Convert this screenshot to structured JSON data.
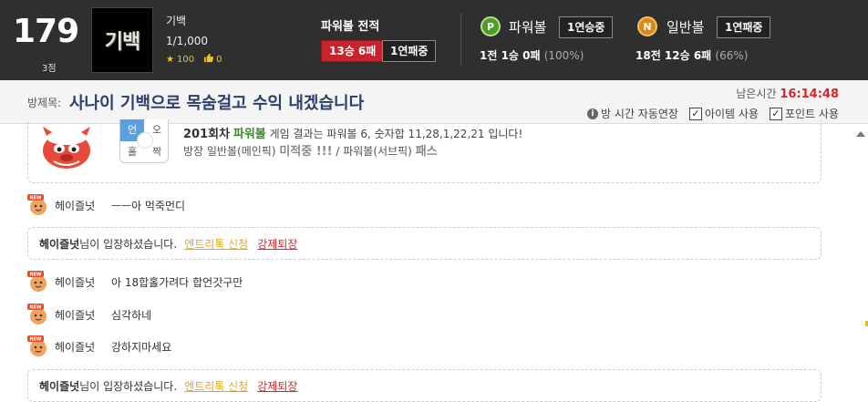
{
  "header": {
    "rank": "179",
    "rank_sub": "3점",
    "logo_text": "기백",
    "user_name": "기백",
    "user_count": "1/1,000",
    "star_count": "100",
    "like_count": "0"
  },
  "powerball_record": {
    "title": "파워볼 전적",
    "record_badge": "13승 6패",
    "streak_badge": "1연패중"
  },
  "ball_stats": [
    {
      "icon": "P",
      "name": "파워볼",
      "streak": "1연승중",
      "record": "1전 1승 0패",
      "percent": "(100%)",
      "color": "#4f9a2a"
    },
    {
      "icon": "N",
      "name": "일반볼",
      "streak": "1연패중",
      "record": "18전 12승 6패",
      "percent": "(66%)",
      "color": "#d98a1a"
    }
  ],
  "room": {
    "label": "방제목:",
    "title": "사나이 기백으로 목숨걸고 수익 내겠습니다",
    "timer_label": "남은시간",
    "timer_value": "16:14:48",
    "option_auto": "방 시간 자동연장",
    "option_item": "아이템 사용",
    "option_point": "포인트 사용"
  },
  "result": {
    "compass": [
      "언",
      "오",
      "홀",
      "짝"
    ],
    "round": "201회차",
    "game": "파워볼",
    "text": " 게임 결과는 파워볼 6, 숫자합 11,28,1,22,21 입니다!",
    "line2_a": "방장 일반볼(메인픽) ",
    "line2_b": "미적중 !!!",
    "line2_c": " / 파워볼(서브픽) ",
    "line2_d": "패스"
  },
  "messages": [
    {
      "nick": "헤이즐넛",
      "text": "ㅡㅡ아 먹죽먼디"
    },
    {
      "nick": "헤이즐넛",
      "text": "아 18합홀가려다 합언갓구만"
    },
    {
      "nick": "헤이즐넛",
      "text": "심각하네"
    },
    {
      "nick": "헤이즐넛",
      "text": "강하지마세요"
    }
  ],
  "enter_notice": {
    "nick": "헤이즐넛",
    "suffix": "님이 입장하셨습니다.",
    "entry_link": "엔트리톡 신청",
    "kick_link": "강제퇴장"
  },
  "avatar_badge": "NEW"
}
